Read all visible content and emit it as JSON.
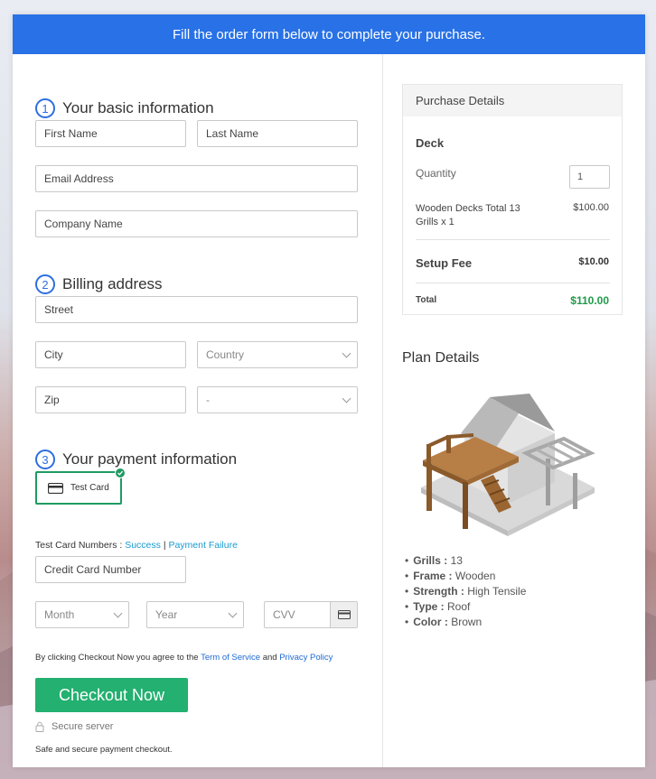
{
  "banner": "Fill the order form below to complete your purchase.",
  "sections": {
    "basic": {
      "num": "1",
      "title": "Your basic information"
    },
    "billing": {
      "num": "2",
      "title": "Billing address"
    },
    "payment": {
      "num": "3",
      "title": "Your payment information"
    }
  },
  "fields": {
    "first_name": "First Name",
    "last_name": "Last Name",
    "email": "Email Address",
    "company": "Company Name",
    "street": "Street",
    "city": "City",
    "country": "Country",
    "zip": "Zip",
    "state": "-",
    "credit_card": "Credit Card Number",
    "month": "Month",
    "year": "Year",
    "cvv": "CVV"
  },
  "payment": {
    "card_option": "Test Card",
    "test_numbers_label": "Test Card Numbers :",
    "success": "Success",
    "separator": "|",
    "failure": "Payment Failure"
  },
  "agreement": {
    "prefix": "By clicking Checkout Now you agree to the",
    "tos": "Term of Service",
    "and": "and",
    "privacy": "Privacy Policy"
  },
  "checkout_button": "Checkout Now",
  "secure_server": "Secure server",
  "safe_text": "Safe and secure payment checkout.",
  "purchase": {
    "header": "Purchase Details",
    "product": "Deck",
    "quantity_label": "Quantity",
    "quantity_value": "1",
    "item_line1": "Wooden Decks Total 13",
    "item_line2": "Grills x 1",
    "item_price": "$100.00",
    "setup_label": "Setup Fee",
    "setup_price": "$10.00",
    "total_label": "Total",
    "total_price": "$110.00"
  },
  "plan": {
    "title": "Plan Details",
    "items": [
      {
        "key": "Grills :",
        "value": "13"
      },
      {
        "key": "Frame :",
        "value": "Wooden"
      },
      {
        "key": "Strength :",
        "value": "High Tensile"
      },
      {
        "key": "Type :",
        "value": "Roof"
      },
      {
        "key": "Color :",
        "value": "Brown"
      }
    ]
  },
  "colors": {
    "primary": "#2871e6",
    "success": "#23b070",
    "total": "#1f9a4a"
  },
  "icons": {
    "check": "check-icon",
    "card": "credit-card-icon",
    "lock": "lock-icon",
    "chevron": "chevron-down-icon"
  }
}
